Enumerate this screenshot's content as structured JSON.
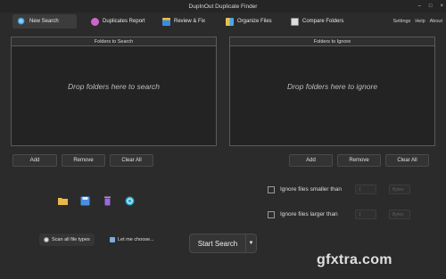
{
  "window": {
    "title": "DupInOut Duplicate Finder",
    "controls": [
      "–",
      "□",
      "×"
    ]
  },
  "tabs": [
    {
      "label": "New Search",
      "icon": "magnifier-icon",
      "color": "#4aa3e0",
      "active": true
    },
    {
      "label": "Duplicates Report",
      "icon": "report-icon",
      "color": "#d065c8",
      "active": false
    },
    {
      "label": "Review & Fix",
      "icon": "review-icon",
      "color": "#3d8be0",
      "active": false
    },
    {
      "label": "Organize Files",
      "icon": "organize-icon",
      "color": "#4aa8e8",
      "active": false
    },
    {
      "label": "Compare Folders",
      "icon": "compare-icon",
      "color": "#dcdcdc",
      "active": false
    }
  ],
  "top_links": {
    "settings": "Settings",
    "help": "Help",
    "about": "About"
  },
  "left_panel": {
    "header": "Folders to Search",
    "placeholder": "Drop folders here to search"
  },
  "right_panel": {
    "header": "Folders to Ignore",
    "placeholder": "Drop folders here to ignore"
  },
  "left_buttons": {
    "add": "Add",
    "remove": "Remove",
    "clear": "Clear All"
  },
  "right_buttons": {
    "add": "Add",
    "remove": "Remove",
    "clear": "Clear All"
  },
  "action_icons": [
    {
      "name": "folder-icon",
      "color": "#e8b84a"
    },
    {
      "name": "save-icon",
      "color": "#4a8ee0"
    },
    {
      "name": "trash-icon",
      "color": "#9a6ad8"
    },
    {
      "name": "refresh-icon",
      "color": "#2aa8c8"
    }
  ],
  "options": {
    "smaller_label": "Ignore files smaller than",
    "larger_label": "Ignore files larger than",
    "smaller_value": "1",
    "larger_value": "1",
    "unit": "Bytes"
  },
  "bottom": {
    "scan_all": "Scan all file types",
    "let_me_choose": "Let me choose...",
    "start": "Start Search"
  },
  "watermark": "gfxtra.com"
}
